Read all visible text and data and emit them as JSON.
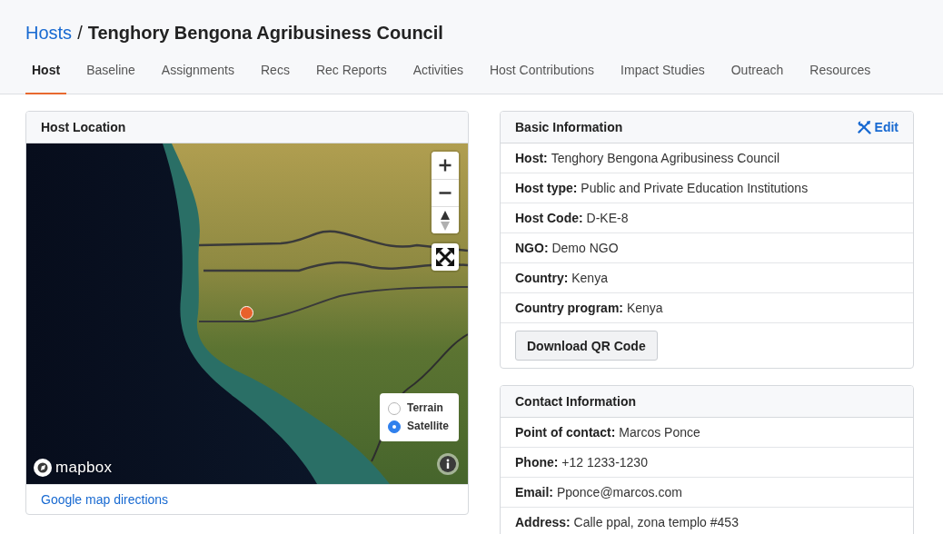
{
  "breadcrumb": {
    "link": "Hosts",
    "separator": "/",
    "title": "Tenghory Bengona Agribusiness Council"
  },
  "tabs": [
    {
      "label": "Host",
      "selected": true
    },
    {
      "label": "Baseline",
      "selected": false
    },
    {
      "label": "Assignments",
      "selected": false
    },
    {
      "label": "Recs",
      "selected": false
    },
    {
      "label": "Rec Reports",
      "selected": false
    },
    {
      "label": "Activities",
      "selected": false
    },
    {
      "label": "Host Contributions",
      "selected": false
    },
    {
      "label": "Impact Studies",
      "selected": false
    },
    {
      "label": "Outreach",
      "selected": false
    },
    {
      "label": "Resources",
      "selected": false
    }
  ],
  "location_card": {
    "title": "Host Location",
    "map": {
      "layers": [
        {
          "label": "Terrain",
          "selected": false
        },
        {
          "label": "Satellite",
          "selected": true
        }
      ],
      "logo": "mapbox"
    },
    "link": "Google map directions"
  },
  "basic_info": {
    "title": "Basic Information",
    "edit_label": "Edit",
    "rows": [
      {
        "label": "Host:",
        "value": "Tenghory Bengona Agribusiness Council"
      },
      {
        "label": "Host type:",
        "value": "Public and Private Education Institutions"
      },
      {
        "label": "Host Code:",
        "value": "D-KE-8"
      },
      {
        "label": "NGO:",
        "value": "Demo NGO"
      },
      {
        "label": "Country:",
        "value": "Kenya"
      },
      {
        "label": "Country program:",
        "value": "Kenya"
      }
    ],
    "button": "Download QR Code"
  },
  "contact_info": {
    "title": "Contact Information",
    "rows": [
      {
        "label": "Point of contact:",
        "value": "Marcos Ponce"
      },
      {
        "label": "Phone:",
        "value": "+12 1233-1230"
      },
      {
        "label": "Email:",
        "value": "Pponce@marcos.com"
      },
      {
        "label": "Address:",
        "value": "Calle ppal, zona templo #453"
      }
    ]
  }
}
